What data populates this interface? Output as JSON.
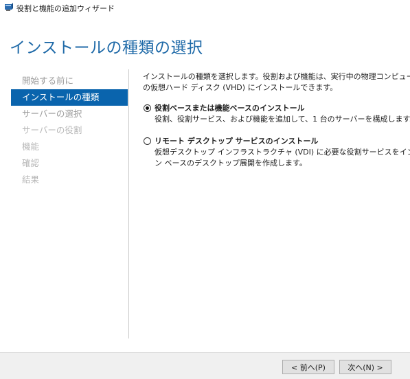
{
  "window": {
    "title": "役割と機能の追加ウィザード"
  },
  "page": {
    "heading": "インストールの種類の選択"
  },
  "sidebar": {
    "items": [
      {
        "label": "開始する前に",
        "state": "light"
      },
      {
        "label": "インストールの種類",
        "state": "active"
      },
      {
        "label": "サーバーの選択",
        "state": "light"
      },
      {
        "label": "サーバーの役割",
        "state": "disabled"
      },
      {
        "label": "機能",
        "state": "disabled"
      },
      {
        "label": "確認",
        "state": "disabled"
      },
      {
        "label": "結果",
        "state": "disabled"
      }
    ]
  },
  "content": {
    "description_line1": "インストールの種類を選択します。役割および機能は、実行中の物理コンピューター、仮",
    "description_line2": "の仮想ハード ディスク (VHD) にインストールできます。",
    "options": [
      {
        "label": "役割ベースまたは機能ベースのインストール",
        "selected": true,
        "desc_lines": [
          "役割、役割サービス、および機能を追加して、1 台のサーバーを構成します。"
        ]
      },
      {
        "label": "リモート デスクトップ サービスのインストール",
        "selected": false,
        "desc_lines": [
          "仮想デスクトップ インフラストラクチャ (VDI) に必要な役割サービスをインストールして",
          "ン ベースのデスクトップ展開を作成します。"
        ]
      }
    ]
  },
  "footer": {
    "prev_label": "< 前へ(P)",
    "next_label": "次へ(N) >"
  },
  "colors": {
    "heading": "#1f6aa8",
    "active_item_bg": "#0a64ad",
    "footer_bg": "#f0f0f0"
  }
}
